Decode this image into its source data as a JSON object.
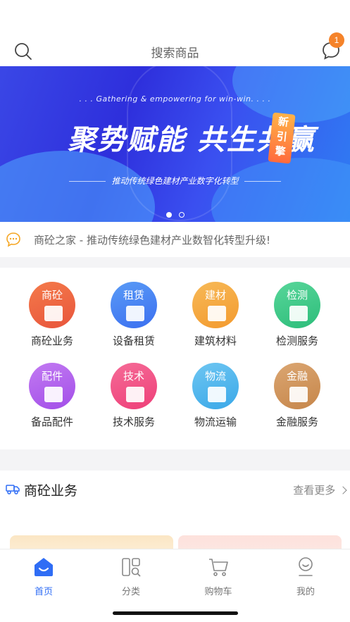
{
  "header": {
    "search_placeholder": "搜索商品",
    "message_badge": "1",
    "search_icon": "search-icon",
    "message_icon": "chat-bubble-icon"
  },
  "banner": {
    "subtitle": ". . . Gathering & empowering for win-win. . . .",
    "headline": "聚势赋能  共生共赢",
    "tag": "新引擎",
    "tagline": "推动传统绿色建材产业数字化转型",
    "slides_total": 2,
    "active_slide": 1
  },
  "notice": {
    "icon": "message-dots-icon",
    "text": "商砼之家 - 推动传统绿色建材产业数智化转型升级!"
  },
  "categories": [
    {
      "badge": "商砼",
      "label": "商砼业务",
      "color": "#e8553c",
      "color2": "#f47a4a"
    },
    {
      "badge": "租赁",
      "label": "设备租赁",
      "color": "#3b6ff0",
      "color2": "#5a9bf6"
    },
    {
      "badge": "建材",
      "label": "建筑材料",
      "color": "#f39a2e",
      "color2": "#f7b957"
    },
    {
      "badge": "检测",
      "label": "检测服务",
      "color": "#2dbd7a",
      "color2": "#58d69a"
    },
    {
      "badge": "配件",
      "label": "备品配件",
      "color": "#a24ee8",
      "color2": "#c27af2"
    },
    {
      "badge": "技术",
      "label": "技术服务",
      "color": "#ee3f78",
      "color2": "#f56b97"
    },
    {
      "badge": "物流",
      "label": "物流运输",
      "color": "#3aa8e8",
      "color2": "#6ec6f2"
    },
    {
      "badge": "金融",
      "label": "金融服务",
      "color": "#c6864a",
      "color2": "#dba672"
    }
  ],
  "section": {
    "icon": "truck-icon",
    "title": "商砼业务",
    "more": "查看更多",
    "more_icon": "chevron-right-icon"
  },
  "tabbar": {
    "items": [
      {
        "label": "首页",
        "icon": "home-icon",
        "active": true
      },
      {
        "label": "分类",
        "icon": "category-icon",
        "active": false
      },
      {
        "label": "购物车",
        "icon": "cart-icon",
        "active": false
      },
      {
        "label": "我的",
        "icon": "user-icon",
        "active": false
      }
    ],
    "active_color": "#2f6df5"
  }
}
